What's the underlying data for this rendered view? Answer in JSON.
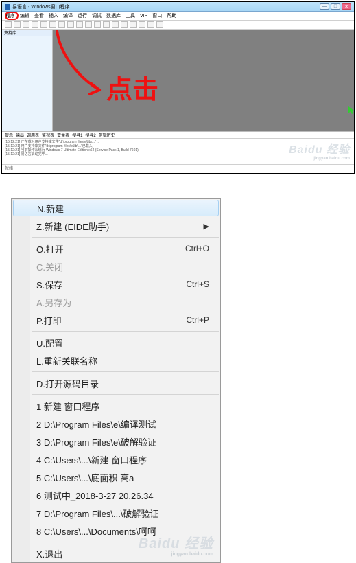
{
  "app": {
    "title": "易语言 - Windows窗口程序",
    "menus": [
      "程序",
      "编辑",
      "查看",
      "插入",
      "编译",
      "运行",
      "调试",
      "数据库",
      "工具",
      "VIP",
      "窗口",
      "帮助"
    ],
    "side_header": "支持库",
    "bottom_tabs": [
      "提示",
      "输出",
      "调用表",
      "监视表",
      "变量表",
      "搜寻1",
      "搜寻2",
      "剪辑历史"
    ],
    "log_lines": [
      "[15:12:21] 正在载入用户支持库文件\"d:\\program files\\e\\lib\\...\" ...",
      "[15:12:21] 用户支持库文件\"d:\\program files\\e\\lib\\...\"已载入",
      "[15:12:21] 当前操作系统为 Windows 7 Ultimate Edition x64 (Service Pack 1, Build 7601)",
      "[15:12:21] 易语言启动完毕..."
    ],
    "status": "就绪",
    "watermark": "Baidu 经验",
    "watermark_sub": "jingyan.baidu.com",
    "handwriting": "点击"
  },
  "context_menu": {
    "groups": [
      [
        {
          "label": "N.新建",
          "interact": true,
          "highlight": true
        },
        {
          "label": "Z.新建 (EIDE助手)",
          "interact": true,
          "submenu": true
        }
      ],
      [
        {
          "label": "O.打开",
          "shortcut": "Ctrl+O",
          "interact": true
        },
        {
          "label": "C.关闭",
          "interact": false
        },
        {
          "label": "S.保存",
          "shortcut": "Ctrl+S",
          "interact": true
        },
        {
          "label": "A.另存为",
          "interact": false
        },
        {
          "label": "P.打印",
          "shortcut": "Ctrl+P",
          "interact": true
        }
      ],
      [
        {
          "label": "U.配置",
          "interact": true
        },
        {
          "label": "L.重新关联名称",
          "interact": true
        }
      ],
      [
        {
          "label": "D.打开源码目录",
          "interact": true
        }
      ],
      [
        {
          "label": "1 新建 窗口程序",
          "interact": true
        },
        {
          "label": "2 D:\\Program Files\\e\\编译测试",
          "interact": true
        },
        {
          "label": "3 D:\\Program Files\\e\\破解验证",
          "interact": true
        },
        {
          "label": "4 C:\\Users\\...\\新建 窗口程序",
          "interact": true
        },
        {
          "label": "5 C:\\Users\\...\\底面积 高a",
          "interact": true
        },
        {
          "label": "6 测试中_2018-3-27 20.26.34",
          "interact": true
        },
        {
          "label": "7 D:\\Program Files\\...\\破解验证",
          "interact": true
        },
        {
          "label": "8 C:\\Users\\...\\Documents\\呵呵",
          "interact": true
        }
      ],
      [
        {
          "label": "X.退出",
          "interact": true
        }
      ]
    ]
  }
}
